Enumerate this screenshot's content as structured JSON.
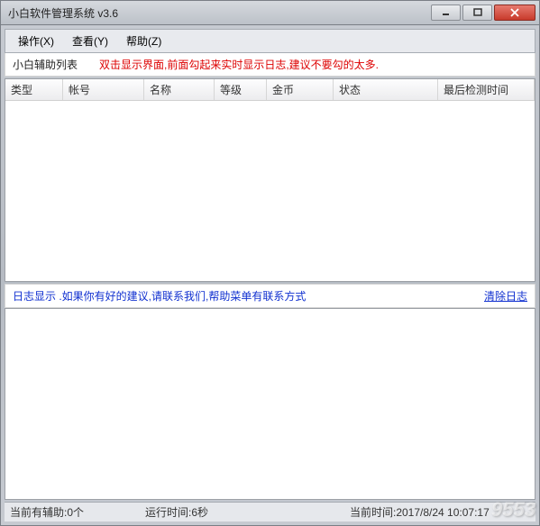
{
  "window": {
    "title": "小白软件管理系统   v3.6"
  },
  "menu": {
    "items": [
      "操作(X)",
      "查看(Y)",
      "帮助(Z)"
    ]
  },
  "helper_list": {
    "title": "小白辅助列表",
    "hint": "双击显示界面,前面勾起来实时显示日志,建议不要勾的太多.",
    "columns": [
      "类型",
      "帐号",
      "名称",
      "等级",
      "金币",
      "状态",
      "最后检测时间"
    ],
    "rows": []
  },
  "log": {
    "header": "日志显示 .如果你有好的建议,请联系我们,帮助菜单有联系方式",
    "clear_link": "清除日志",
    "content": ""
  },
  "status": {
    "helper_count": "当前有辅助:0个",
    "runtime": "运行时间:6秒",
    "current_time": "当前时间:2017/8/24 10:07:17"
  },
  "watermark": "9553"
}
